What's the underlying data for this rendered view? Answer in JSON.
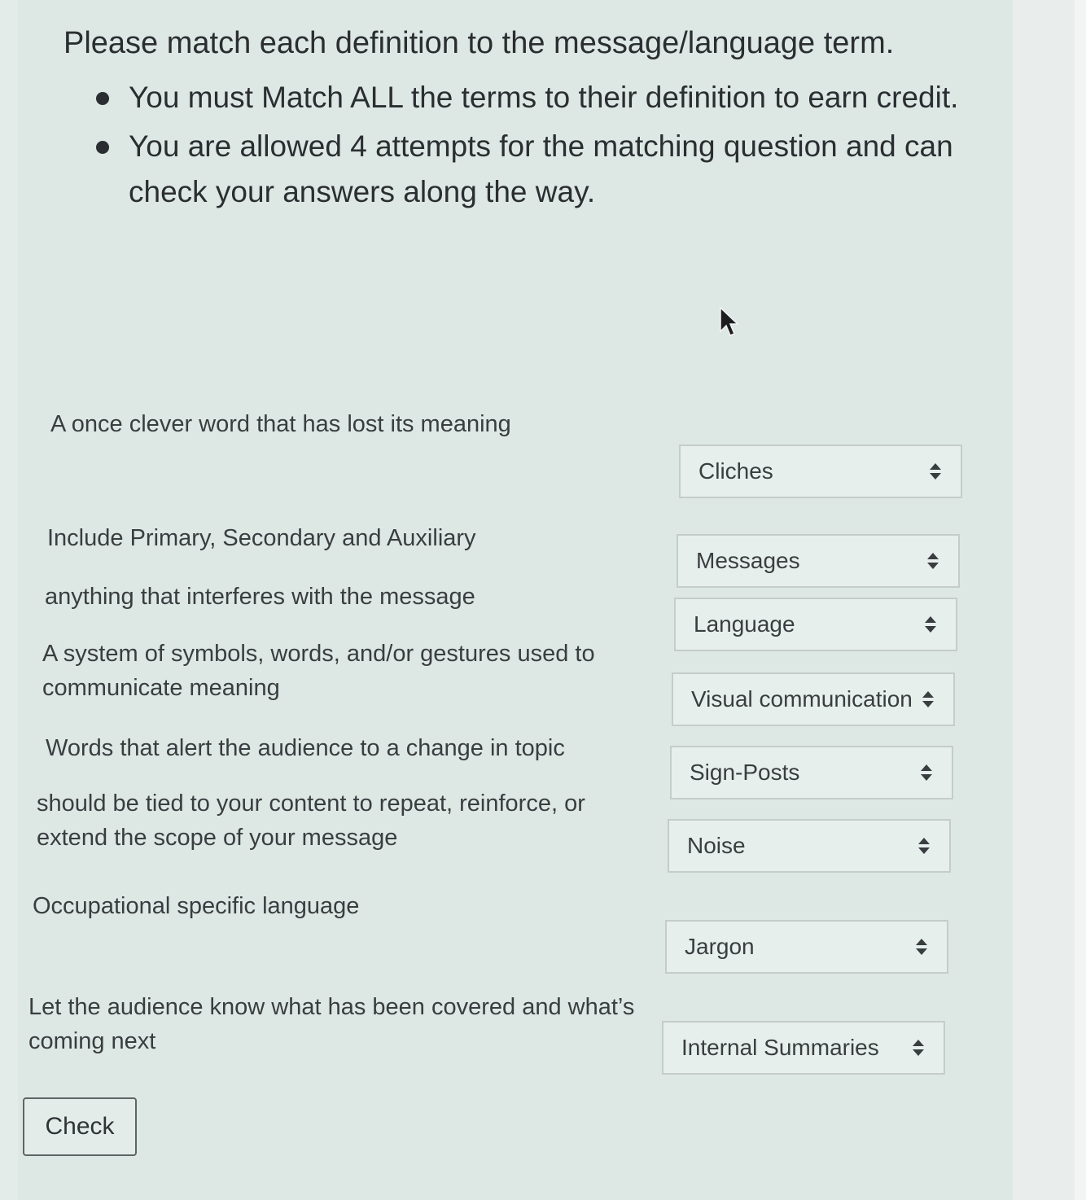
{
  "instructions": {
    "title": "Please match each definition to the message/language term.",
    "bullets": [
      "You must Match ALL the terms to their definition to earn credit.",
      "You are allowed 4 attempts for the matching question and can check your answers along the way."
    ]
  },
  "pairs": [
    {
      "definition": "A once clever word that has lost its meaning",
      "selected": "Cliches"
    },
    {
      "definition": "Include Primary, Secondary and Auxiliary",
      "selected": "Messages"
    },
    {
      "definition": "anything that interferes with the message",
      "selected": "Language"
    },
    {
      "definition": "A system of symbols, words, and/or gestures used to communicate meaning",
      "selected": "Visual communication"
    },
    {
      "definition": "Words that alert the audience to a change in topic",
      "selected": "Sign-Posts"
    },
    {
      "definition": "should be tied to your content to repeat, reinforce, or extend the scope of your message",
      "selected": "Noise"
    },
    {
      "definition": "Occupational specific language",
      "selected": "Jargon"
    },
    {
      "definition": "Let the audience know what has been covered and what’s coming next",
      "selected": "Internal Summaries"
    }
  ],
  "check_label": "Check",
  "icons": {
    "select_caret": "up-down-caret-icon",
    "pointer": "mouse-pointer-icon"
  }
}
